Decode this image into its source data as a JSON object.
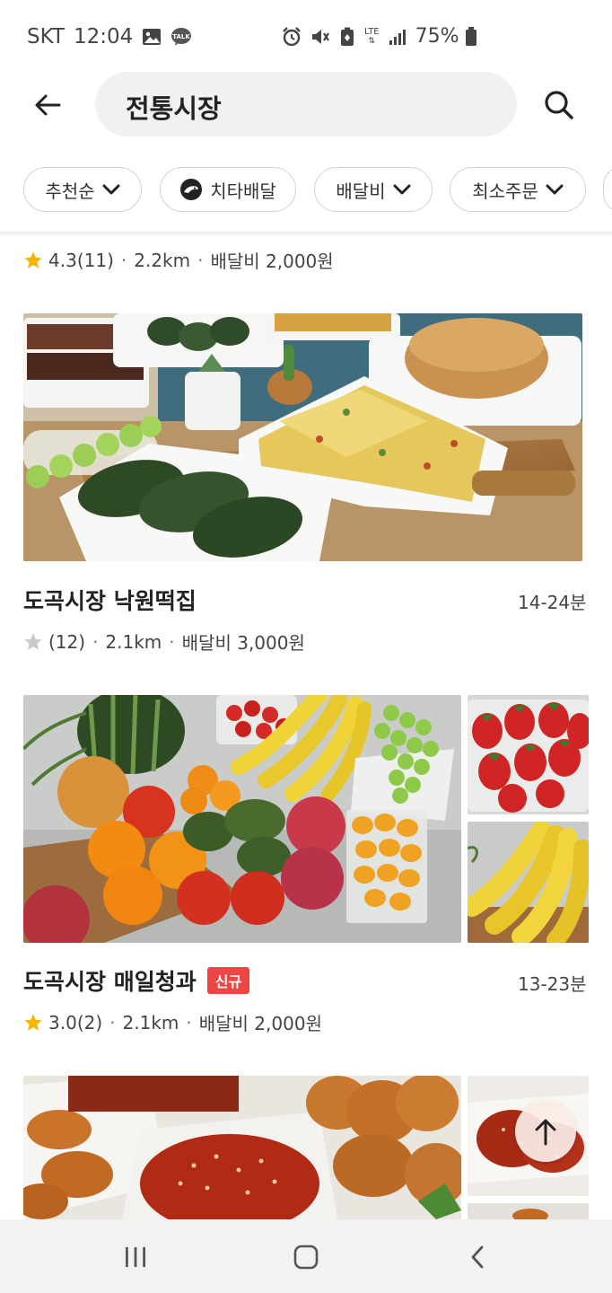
{
  "status_bar": {
    "carrier": "SKT",
    "time": "12:04",
    "network": "LTE",
    "battery": "75%",
    "icons": [
      "gallery-icon",
      "kakaotalk-icon",
      "alarm-icon",
      "mute-icon",
      "battery-saver-icon",
      "signal-icon",
      "battery-icon"
    ],
    "kakao_label": "TALK"
  },
  "search": {
    "query": "전통시장"
  },
  "filters": {
    "sort": "추천순",
    "cheetah": "치타배달",
    "delivery_fee": "배달비",
    "min_order": "최소주문"
  },
  "stores": [
    {
      "rating": "4.3",
      "reviews": "(11)",
      "distance": "2.2km",
      "fee": "배달비 2,000원",
      "partial": true
    },
    {
      "name": "도곡시장 낙원떡집",
      "eta": "14-24분",
      "rating": "",
      "reviews": "(12)",
      "distance": "2.1km",
      "fee": "배달비 3,000원",
      "image": "rice-cake-food-photo"
    },
    {
      "name": "도곡시장 매일청과",
      "badge": "신규",
      "eta": "13-23분",
      "rating": "3.0",
      "reviews": "(2)",
      "distance": "2.1km",
      "fee": "배달비 2,000원",
      "image": "fruit-food-photo"
    },
    {
      "image": "fried-chicken-food-photo",
      "partial": true
    }
  ],
  "colors": {
    "star": "#f7b500",
    "star_empty": "#c8cacd",
    "badge": "#ef4545",
    "chip_border": "#cfd2d6",
    "search_bg": "#f0f1f3"
  },
  "nav": {
    "recent": "recent-apps-icon",
    "home": "home-icon",
    "back": "back-icon"
  }
}
